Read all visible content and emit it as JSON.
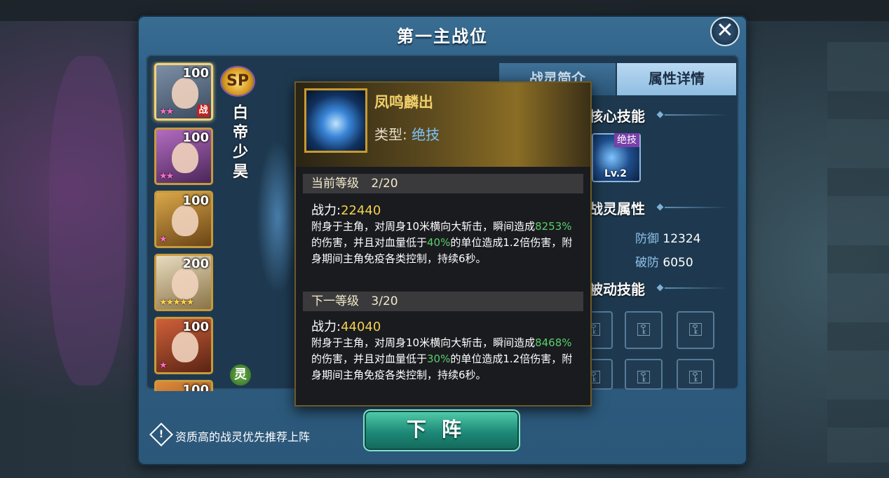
{
  "dialog": {
    "title": "第一主战位",
    "close_label": "✕"
  },
  "roster": [
    {
      "level": "100",
      "stars": "★★",
      "star_color": "pink",
      "deployed_tag": "战"
    },
    {
      "level": "100",
      "stars": "★★",
      "star_color": "pink"
    },
    {
      "level": "100",
      "stars": "★",
      "star_color": "pink"
    },
    {
      "level": "200",
      "stars": "★★★★★",
      "star_color": "gold"
    },
    {
      "level": "100",
      "stars": "★",
      "star_color": "pink"
    },
    {
      "level": "100"
    }
  ],
  "character": {
    "sp_badge": "SP",
    "name": "白帝少昊",
    "element_badge": "灵"
  },
  "tabs": [
    {
      "label": "战灵简介"
    },
    {
      "label": "属性详情"
    }
  ],
  "right_panel": {
    "core_skill_title": "核心技能",
    "core_skill": {
      "tag": "绝技",
      "level": "Lv.2"
    },
    "attr_title": "战灵属性",
    "attrs": [
      {
        "key": "防御",
        "value": "12324"
      },
      {
        "key": "破防",
        "value": "6050"
      }
    ],
    "passive_title": "被动技能"
  },
  "tooltip": {
    "skill_name": "凤鸣麟出",
    "type_label": "类型:",
    "type_value": "绝技",
    "current": {
      "header": "当前等级",
      "level": "2/20",
      "power_label": "战力:",
      "power_value": "22440",
      "desc_a": "附身于主角，对周身10米横向大斩击，瞬间造成",
      "desc_pct1": "8253%",
      "desc_b": "的伤害，并且对血量低于",
      "desc_pct2": "40%",
      "desc_c": "的单位造成1.2倍伤害，附身期间主角免疫各类控制，持续6秒。"
    },
    "next": {
      "header": "下一等级",
      "level": "3/20",
      "power_label": "战力:",
      "power_value": "44040",
      "desc_a": "附身于主角，对周身10米横向大斩击，瞬间造成",
      "desc_pct1": "8468%",
      "desc_b": "的伤害，并且对血量低于",
      "desc_pct2": "30%",
      "desc_c": "的单位造成1.2倍伤害，附身期间主角免疫各类控制，持续6秒。"
    }
  },
  "footer": {
    "tip_icon": "!",
    "tip_text": "资质高的战灵优先推荐上阵",
    "undeploy_button": "下阵"
  },
  "colors": {
    "accent_gold": "#f2d04d",
    "highlight_green": "#58d06a",
    "type_blue": "#7bc4ff"
  }
}
